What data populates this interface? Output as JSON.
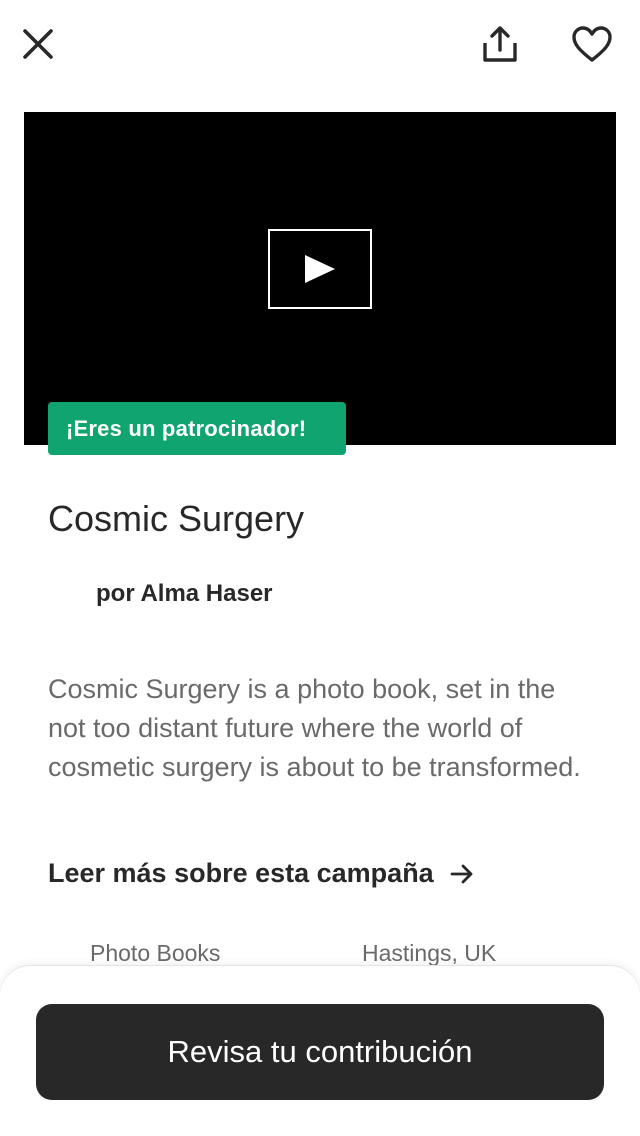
{
  "toolbar": {
    "close_icon": "close-icon",
    "share_icon": "share-icon",
    "heart_icon": "heart-icon"
  },
  "video": {
    "play_icon": "play-icon"
  },
  "badge": {
    "label": "¡Eres un patrocinador!",
    "color": "#0FA470"
  },
  "project": {
    "title": "Cosmic Surgery",
    "creator_prefix": "por",
    "creator_name": "Alma Haser",
    "blurb": "Cosmic Surgery is a photo book, set in the not too distant future where the world of cosmetic surgery is about to be transformed.",
    "read_more_label": "Leer más sobre esta campaña",
    "category": "Photo Books",
    "location": "Hastings, UK"
  },
  "cta": {
    "label": "Revisa tu contribución",
    "color": "#282828"
  }
}
